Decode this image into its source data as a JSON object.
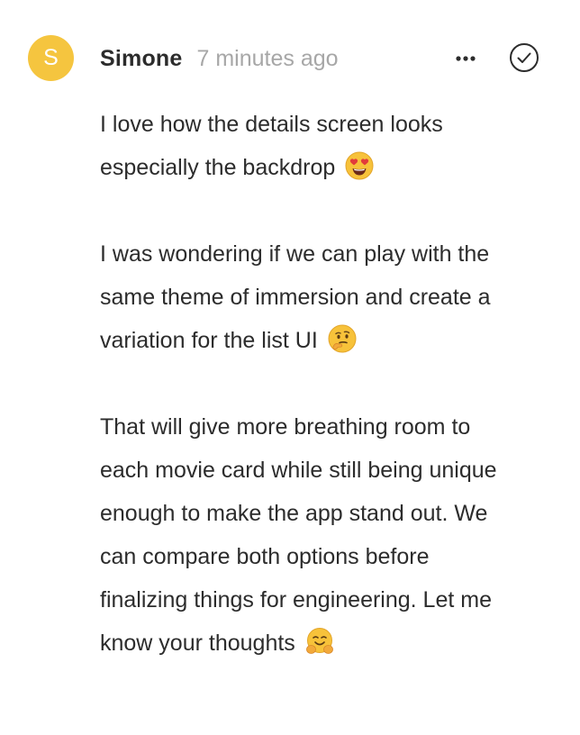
{
  "comment": {
    "avatar_initial": "S",
    "author": "Simone",
    "timestamp": "7 minutes ago",
    "more_label": "•••",
    "paragraphs": [
      {
        "text": "I love how the details screen looks especially the backdrop",
        "emoji": "heart-eyes-emoji-icon"
      },
      {
        "text": "I was wondering if we can play with the same theme of immersion and create a variation for the list UI",
        "emoji": "thinking-face-emoji-icon"
      },
      {
        "text": "That will give more breathing room to each movie card while still being unique enough to make the app stand out. We can compare both options before finalizing things for engineering. Let me know your thoughts",
        "emoji": "hugging-face-emoji-icon"
      }
    ]
  },
  "colors": {
    "avatar_bg": "#f5c53f",
    "text": "#2c2c2c",
    "muted": "#a7a7a7"
  }
}
